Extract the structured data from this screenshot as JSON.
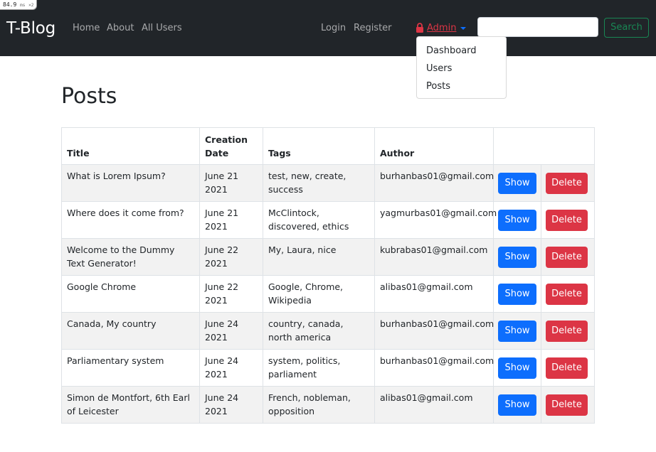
{
  "perf": {
    "value": "84.9",
    "unit": "ms",
    "multiplier": "×2"
  },
  "navbar": {
    "brand": "T-Blog",
    "links": [
      "Home",
      "About",
      "All Users"
    ],
    "login": "Login",
    "register": "Register",
    "admin": "Admin",
    "search_placeholder": "",
    "search_value": "",
    "search_button": "Search"
  },
  "admin_menu": {
    "items": [
      "Dashboard",
      "Users",
      "Posts"
    ]
  },
  "page": {
    "title": "Posts"
  },
  "table": {
    "headers": {
      "title": "Title",
      "date": "Creation Date",
      "tags": "Tags",
      "author": "Author"
    },
    "show_label": "Show",
    "delete_label": "Delete",
    "rows": [
      {
        "title": "What is Lorem Ipsum?",
        "date": "June 21 2021",
        "tags": "test, new, create, success",
        "author": "burhanbas01@gmail.com"
      },
      {
        "title": "Where does it come from?",
        "date": "June 21 2021",
        "tags": "McClintock, discovered, ethics",
        "author": "yagmurbas01@gmail.com"
      },
      {
        "title": "Welcome to the Dummy Text Generator!",
        "date": "June 22 2021",
        "tags": "My, Laura, nice",
        "author": "kubrabas01@gmail.com"
      },
      {
        "title": "Google Chrome",
        "date": "June 22 2021",
        "tags": "Google, Chrome, Wikipedia",
        "author": "alibas01@gmail.com"
      },
      {
        "title": "Canada, My country",
        "date": "June 24 2021",
        "tags": "country, canada, north america",
        "author": "burhanbas01@gmail.com"
      },
      {
        "title": "Parliamentary system",
        "date": "June 24 2021",
        "tags": "system, politics, parliament",
        "author": "burhanbas01@gmail.com"
      },
      {
        "title": "Simon de Montfort, 6th Earl of Leicester",
        "date": "June 24 2021",
        "tags": "French, nobleman, opposition",
        "author": "alibas01@gmail.com"
      }
    ]
  },
  "colors": {
    "navbar_bg": "#212529",
    "primary": "#0d6efd",
    "danger": "#dc3545",
    "success": "#198754",
    "stripe": "#f2f2f2"
  }
}
